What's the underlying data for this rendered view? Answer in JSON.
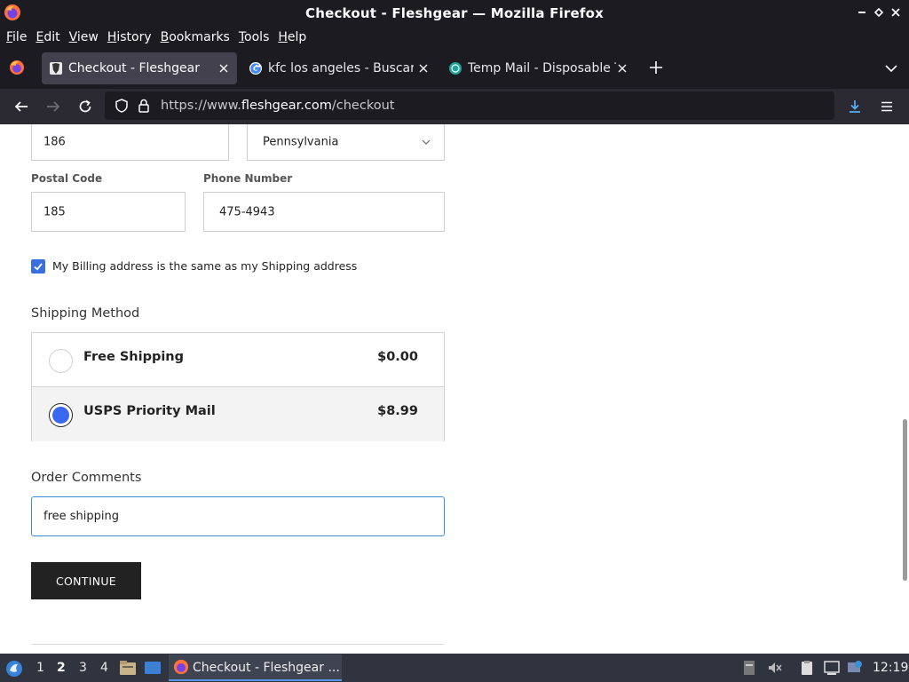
{
  "window": {
    "title": "Checkout - Fleshgear — Mozilla Firefox"
  },
  "menu": [
    "File",
    "Edit",
    "View",
    "History",
    "Bookmarks",
    "Tools",
    "Help"
  ],
  "menu_underline": [
    "F",
    "E",
    "V",
    "H",
    "B",
    "T",
    "H"
  ],
  "menu_rest": [
    "ile",
    "dit",
    "iew",
    "istory",
    "ookmarks",
    "ools",
    "elp"
  ],
  "tabs": [
    {
      "label": "Checkout - Fleshgear",
      "active": true
    },
    {
      "label": "kfc los angeles - Buscar c",
      "active": false
    },
    {
      "label": "Temp Mail - Disposable Te",
      "active": false
    }
  ],
  "url": {
    "prefix": "https://www.",
    "host": "fleshgear.com",
    "path": "/checkout"
  },
  "form": {
    "top_left_value": "186",
    "state_value": "Pennsylvania",
    "postal_label": "Postal Code",
    "postal_value": "185",
    "phone_label": "Phone Number",
    "phone_value": "475-4943",
    "billing_same_label": "My Billing address is the same as my Shipping address",
    "billing_same_checked": true
  },
  "shipping": {
    "title": "Shipping Method",
    "options": [
      {
        "name": "Free Shipping",
        "price": "$0.00",
        "selected": false
      },
      {
        "name": "USPS Priority Mail",
        "price": "$8.99",
        "selected": true
      }
    ]
  },
  "comments": {
    "title": "Order Comments",
    "value": "free shipping"
  },
  "continue_label": "CONTINUE",
  "taskbar": {
    "workspaces": [
      "1",
      "2",
      "3",
      "4"
    ],
    "active_workspace": "2",
    "app_label": "Checkout - Fleshgear ...",
    "clock": "12:19"
  },
  "colors": {
    "accent": "#3b67f0",
    "chrome_dark": "#1c1b22",
    "taskbar": "#2f343f"
  }
}
